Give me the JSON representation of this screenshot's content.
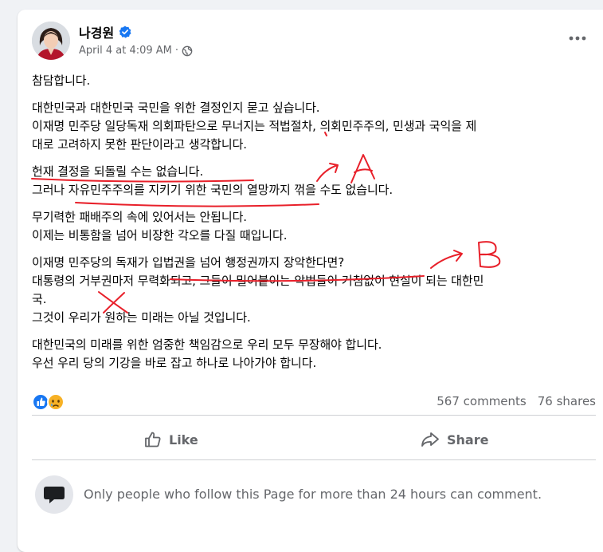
{
  "post": {
    "author": "나경원",
    "timestamp": "April 4 at 4:09 AM",
    "separator": "·",
    "audience_icon": "globe-icon",
    "verified_icon": "verified-badge-icon",
    "more_icon": "more-options-icon",
    "lines": [
      "참담합니다.",
      "",
      "대한민국과 대한민국 국민을 위한 결정인지 묻고 싶습니다.",
      "이재명 민주당 일당독재 의회파탄으로 무너지는 적법절차, 의회민주주의, 민생과 국익을 제",
      "대로 고려하지 못한 판단이라고 생각합니다.",
      "",
      "헌재 결정을 되돌릴 수는 없습니다.",
      "그러나 자유민주주의를 지키기 위한 국민의 열망까지 꺾을 수도 없습니다.",
      "",
      "무기력한 패배주의 속에 있어서는 안됩니다.",
      "이제는 비통함을 넘어 비장한 각오를 다질 때입니다.",
      "",
      "이재명 민주당의 독재가 입법권을 넘어 행정권까지 장악한다면?",
      "대통령의 거부권마저 무력화되고, 그들이 밀어붙이는 악법들이 거침없이 현실이 되는 대한민",
      "국.",
      "그것이 우리가 원하는 미래는 아닐 것입니다.",
      "",
      "대한민국의 미래를 위한 엄중한 책임감으로 우리 모두 무장해야 합니다.",
      "우선 우리 당의 기강을 바로 잡고 하나로 나아가야 합니다."
    ]
  },
  "stats": {
    "reaction_icons": [
      "like-reaction-icon",
      "sad-reaction-icon"
    ],
    "comments": "567 comments",
    "shares": "76 shares"
  },
  "actions": {
    "like": "Like",
    "share": "Share"
  },
  "comment_notice": "Only people who follow this Page for more than 24 hours can comment.",
  "annotations": {
    "label_a": "A",
    "label_b": "B"
  },
  "colors": {
    "annotation": "#e8202a",
    "link_blue": "#1877f2",
    "secondary_text": "#65676b"
  }
}
